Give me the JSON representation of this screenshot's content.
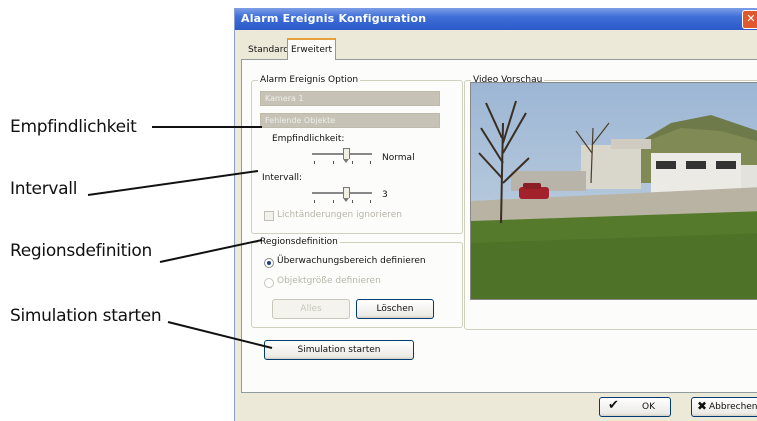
{
  "callouts": [
    {
      "id": "sensitivity",
      "label": "Empfindlichkeit"
    },
    {
      "id": "interval",
      "label": "Intervall"
    },
    {
      "id": "region",
      "label": "Regionsdefinition"
    },
    {
      "id": "simulation",
      "label": "Simulation starten"
    }
  ],
  "window": {
    "title": "Alarm Ereignis Konfiguration",
    "close_label": "✕",
    "tabs": [
      {
        "label": "Standard",
        "active": false
      },
      {
        "label": "Erweitert",
        "active": true
      }
    ]
  },
  "alarm_option": {
    "legend": "Alarm Ereignis Option",
    "camera_field": "Kamera 1",
    "event_field": "Fehlende Objekte",
    "sensitivity_label": "Empfindlichkeit:",
    "sensitivity_value": "Normal",
    "interval_label": "Intervall:",
    "interval_value": "3",
    "ignore_light_label": "Lichtänderungen ignorieren"
  },
  "region": {
    "legend": "Regionsdefinition",
    "option_define_area": "Überwachungsbereich definieren",
    "option_object_size": "Objektgröße definieren",
    "all_button": "Alles",
    "delete_button": "Löschen"
  },
  "preview": {
    "legend": "Video Vorschau"
  },
  "simulation_button": "Simulation starten",
  "footer": {
    "ok_label": "OK",
    "cancel_label": "Abbrechen"
  }
}
